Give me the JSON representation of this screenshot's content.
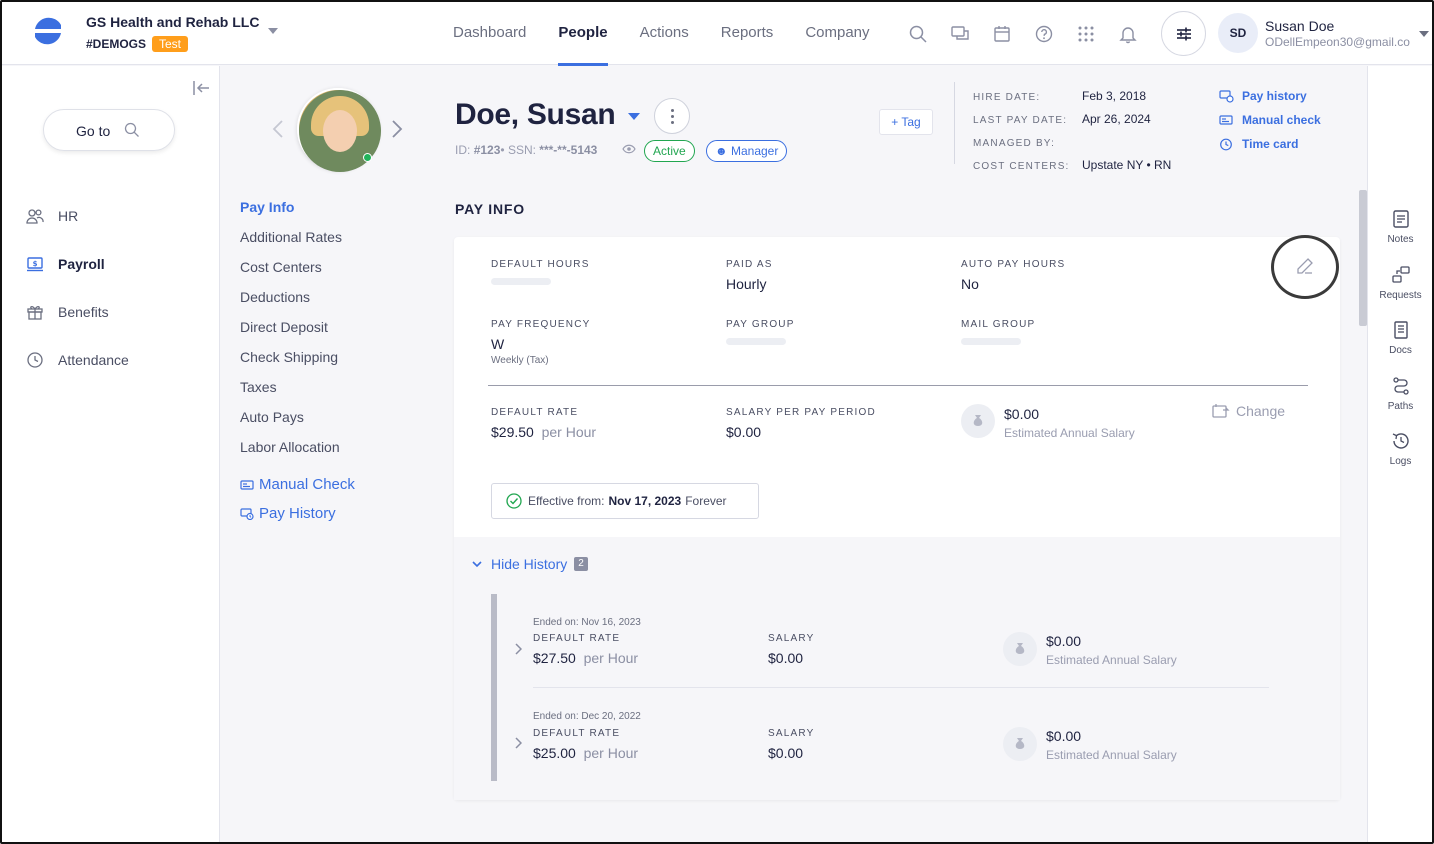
{
  "company": {
    "name": "GS Health and Rehab LLC",
    "code": "#DEMOGS",
    "badge": "Test"
  },
  "nav": {
    "items": [
      "Dashboard",
      "People",
      "Actions",
      "Reports",
      "Company"
    ],
    "active": "People"
  },
  "user": {
    "initials": "SD",
    "name": "Susan Doe",
    "email": "ODellEmpeon30@gmail.co"
  },
  "sidebar": {
    "goto_label": "Go to",
    "items": [
      {
        "label": "HR",
        "icon": "people-icon"
      },
      {
        "label": "Payroll",
        "icon": "payroll-icon",
        "active": true
      },
      {
        "label": "Benefits",
        "icon": "gift-icon"
      },
      {
        "label": "Attendance",
        "icon": "clock-icon"
      }
    ]
  },
  "subnav": {
    "links": [
      "Pay Info",
      "Additional Rates",
      "Cost Centers",
      "Deductions",
      "Direct Deposit",
      "Check Shipping",
      "Taxes",
      "Auto Pays",
      "Labor Allocation"
    ],
    "active": "Pay Info",
    "actions": [
      "Manual Check",
      "Pay History"
    ]
  },
  "employee": {
    "name": "Doe, Susan",
    "id_label": "ID:",
    "id": "#123",
    "ssn_label": "SSN:",
    "ssn": "***-**-5143",
    "status": "Active",
    "role": "Manager",
    "tag_button": "+ Tag"
  },
  "meta": {
    "hire_date_label": "HIRE DATE:",
    "hire_date": "Feb 3, 2018",
    "last_pay_label": "LAST PAY DATE:",
    "last_pay": "Apr 26, 2024",
    "managed_by_label": "MANAGED BY:",
    "cost_centers_label": "COST CENTERS:",
    "cost_centers": "Upstate NY • RN"
  },
  "quick_links": [
    "Pay history",
    "Manual check",
    "Time card"
  ],
  "section_title": "PAY INFO",
  "pay_info": {
    "default_hours_label": "DEFAULT HOURS",
    "paid_as_label": "PAID AS",
    "paid_as": "Hourly",
    "auto_pay_hours_label": "AUTO PAY HOURS",
    "auto_pay_hours": "No",
    "pay_frequency_label": "PAY FREQUENCY",
    "pay_frequency": "W",
    "pay_frequency_sub": "Weekly (Tax)",
    "pay_group_label": "PAY GROUP",
    "mail_group_label": "MAIL GROUP",
    "default_rate_label": "DEFAULT RATE",
    "default_rate": "$29.50",
    "rate_unit": "per Hour",
    "salary_per_period_label": "SALARY PER PAY PERIOD",
    "salary_per_period": "$0.00",
    "est_annual": "$0.00",
    "est_annual_label": "Estimated Annual Salary",
    "change_label": "Change",
    "effective_label": "Effective from:",
    "effective_date": "Nov 17, 2023",
    "effective_suffix": "Forever"
  },
  "history": {
    "toggle_label": "Hide History",
    "count": "2",
    "rows": [
      {
        "ended": "Ended on: Nov 16, 2023",
        "rate_label": "DEFAULT RATE",
        "rate": "$27.50",
        "unit": "per Hour",
        "salary_label": "SALARY",
        "salary": "$0.00",
        "annual": "$0.00",
        "annual_label": "Estimated Annual Salary"
      },
      {
        "ended": "Ended on: Dec 20, 2022",
        "rate_label": "DEFAULT RATE",
        "rate": "$25.00",
        "unit": "per Hour",
        "salary_label": "SALARY",
        "salary": "$0.00",
        "annual": "$0.00",
        "annual_label": "Estimated Annual Salary"
      }
    ]
  },
  "rail": [
    "Notes",
    "Requests",
    "Docs",
    "Paths",
    "Logs"
  ],
  "colors": {
    "accent": "#3b6fe0",
    "success": "#21a650",
    "badge": "#ff9e1b"
  }
}
